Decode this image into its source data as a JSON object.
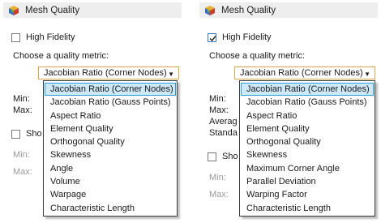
{
  "colors": {
    "select_border": "#d8a848",
    "highlight_bg": "#cde8f7",
    "highlight_border": "#26a0da",
    "checkbox_check": "#3a78c4"
  },
  "left": {
    "header_title": "Mesh Quality",
    "icon": "mesh-cube-icon",
    "high_fidelity_label": "High Fidelity",
    "high_fidelity_checked": false,
    "metric_prompt": "Choose a quality metric:",
    "selected_metric": "Jacobian Ratio (Corner Nodes)",
    "stats_labels": [
      "Min:",
      "Max:"
    ],
    "show_label_fragment": "Sho",
    "bottom_labels": [
      "Min:",
      "Max:"
    ],
    "options": [
      "Jacobian Ratio (Corner Nodes)",
      "Jacobian Ratio (Gauss Points)",
      "Aspect Ratio",
      "Element Quality",
      "Orthogonal Quality",
      "Skewness",
      "Angle",
      "Volume",
      "Warpage",
      "Characteristic Length"
    ]
  },
  "right": {
    "header_title": "Mesh Quality",
    "icon": "mesh-cube-icon",
    "high_fidelity_label": "High Fidelity",
    "high_fidelity_checked": true,
    "metric_prompt": "Choose a quality metric:",
    "selected_metric": "Jacobian Ratio (Corner Nodes)",
    "stats_labels": [
      "Min:",
      "Max:",
      "Averag",
      "Standa"
    ],
    "show_label_fragment": "Sho",
    "bottom_labels": [
      "Min:",
      "Max:"
    ],
    "options": [
      "Jacobian Ratio (Corner Nodes)",
      "Jacobian Ratio (Gauss Points)",
      "Aspect Ratio",
      "Element Quality",
      "Orthogonal Quality",
      "Skewness",
      "Maximum Corner Angle",
      "Parallel Deviation",
      "Warping Factor",
      "Characteristic Length"
    ]
  }
}
